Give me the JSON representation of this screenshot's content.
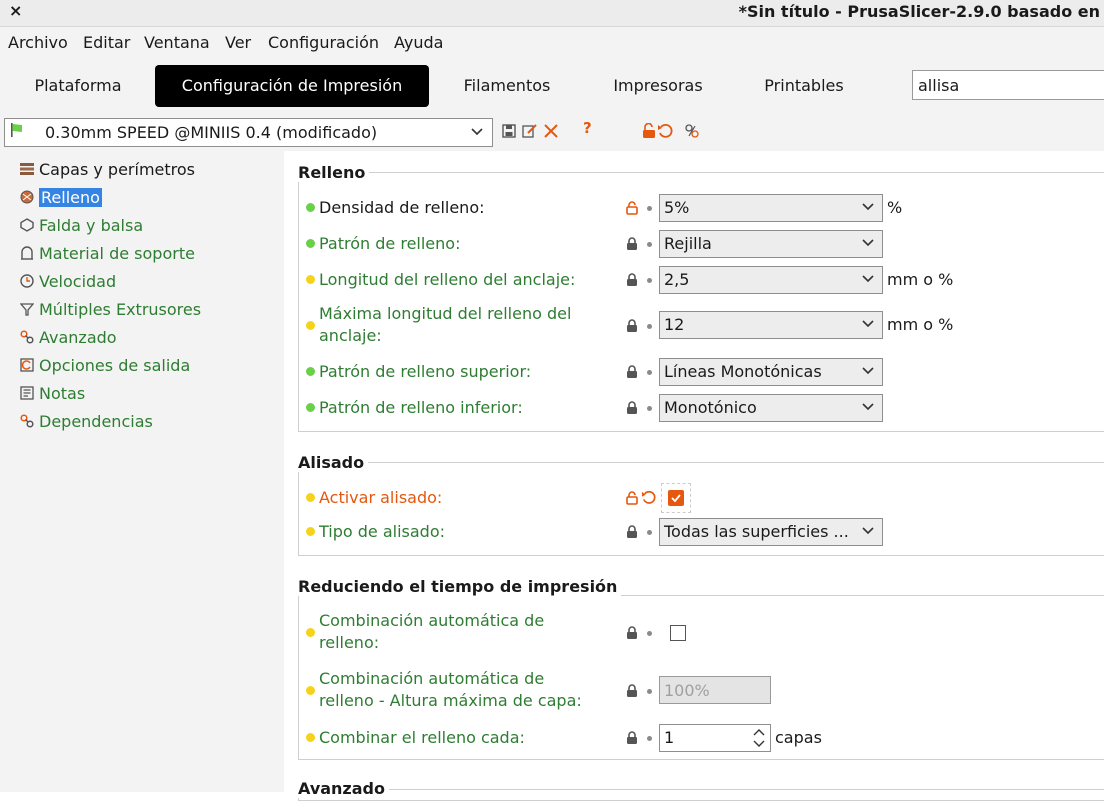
{
  "window": {
    "close_glyph": "×",
    "title": "*Sin título - PrusaSlicer-2.9.0 basado en"
  },
  "menu": [
    "Archivo",
    "Editar",
    "Ventana",
    "Ver",
    "Configuración",
    "Ayuda"
  ],
  "tabs": [
    {
      "label": "Plataforma",
      "active": false
    },
    {
      "label": "Configuración de Impresión",
      "active": true
    },
    {
      "label": "Filamentos",
      "active": false
    },
    {
      "label": "Impresoras",
      "active": false
    },
    {
      "label": "Printables",
      "active": false
    }
  ],
  "search": {
    "value": "allisa"
  },
  "preset": {
    "name": "0.30mm SPEED @MINIIS 0.4 (modificado)",
    "help_glyph": "?"
  },
  "sidebar": {
    "items": [
      {
        "label": "Capas y perímetros",
        "icon": "layers-icon"
      },
      {
        "label": "Relleno",
        "icon": "infill-icon",
        "selected": true
      },
      {
        "label": "Falda y balsa",
        "icon": "skirt-icon"
      },
      {
        "label": "Material de soporte",
        "icon": "support-icon"
      },
      {
        "label": "Velocidad",
        "icon": "clock-icon"
      },
      {
        "label": "Múltiples Extrusores",
        "icon": "funnel-icon"
      },
      {
        "label": "Avanzado",
        "icon": "wrench-icon"
      },
      {
        "label": "Opciones de salida",
        "icon": "output-icon"
      },
      {
        "label": "Notas",
        "icon": "note-icon"
      },
      {
        "label": "Dependencias",
        "icon": "wrench-icon"
      }
    ]
  },
  "sections": {
    "relleno": {
      "title": "Relleno",
      "rows": [
        {
          "label": "Densidad de relleno:",
          "value": "5%",
          "unit": "%"
        },
        {
          "label": "Patrón de relleno:",
          "value": "Rejilla"
        },
        {
          "label": "Longitud del relleno del anclaje:",
          "value": "2,5",
          "unit": "mm o %"
        },
        {
          "label_line1": "Máxima longitud del relleno del",
          "label_line2": "anclaje:",
          "value": "12",
          "unit": "mm o %"
        },
        {
          "label": "Patrón de relleno superior:",
          "value": "Líneas Monotónicas"
        },
        {
          "label": "Patrón de relleno inferior:",
          "value": "Monotónico"
        }
      ]
    },
    "alisado": {
      "title": "Alisado",
      "rows": [
        {
          "label": "Activar alisado:",
          "checked": true
        },
        {
          "label": "Tipo de alisado:",
          "value": "Todas las superficies ..."
        }
      ]
    },
    "reduciendo": {
      "title": "Reduciendo el tiempo de impresión",
      "rows": [
        {
          "label_line1": "Combinación automática de",
          "label_line2": "relleno:",
          "checked": false
        },
        {
          "label_line1": "Combinación automática de",
          "label_line2": "relleno - Altura máxima de capa:",
          "value": "100%"
        },
        {
          "label": "Combinar el relleno cada:",
          "value": "1",
          "unit": "capas"
        }
      ]
    },
    "avanzado": {
      "title": "Avanzado"
    }
  },
  "colors": {
    "accent": "#e6570f",
    "selection": "#3584e4",
    "label_green": "#2e7d32",
    "dot_green": "#6ad04a",
    "dot_yellow": "#f5d31a"
  }
}
